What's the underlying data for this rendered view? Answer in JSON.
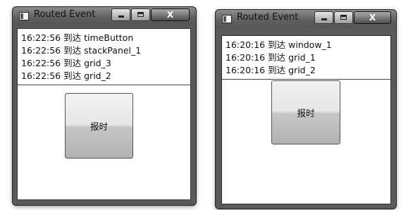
{
  "windows": [
    {
      "title": "Routed Event",
      "events": [
        {
          "time": "16:22:56",
          "verb": "到达",
          "source": "timeButton"
        },
        {
          "time": "16:22:56",
          "verb": "到达",
          "source": "stackPanel_1"
        },
        {
          "time": "16:22:56",
          "verb": "到达",
          "source": "grid_3"
        },
        {
          "time": "16:22:56",
          "verb": "到达",
          "source": "grid_2"
        }
      ],
      "button_label": "报时",
      "caption": {
        "minimize": "minimize-icon",
        "maximize": "maximize-icon",
        "close": "X"
      }
    },
    {
      "title": "Routed Event",
      "events": [
        {
          "time": "16:20:16",
          "verb": "到达",
          "source": "window_1"
        },
        {
          "time": "16:20:16",
          "verb": "到达",
          "source": "grid_1"
        },
        {
          "time": "16:20:16",
          "verb": "到达",
          "source": "grid_2"
        }
      ],
      "button_label": "报时",
      "caption": {
        "minimize": "minimize-icon",
        "maximize": "maximize-icon",
        "close": "X"
      }
    }
  ]
}
